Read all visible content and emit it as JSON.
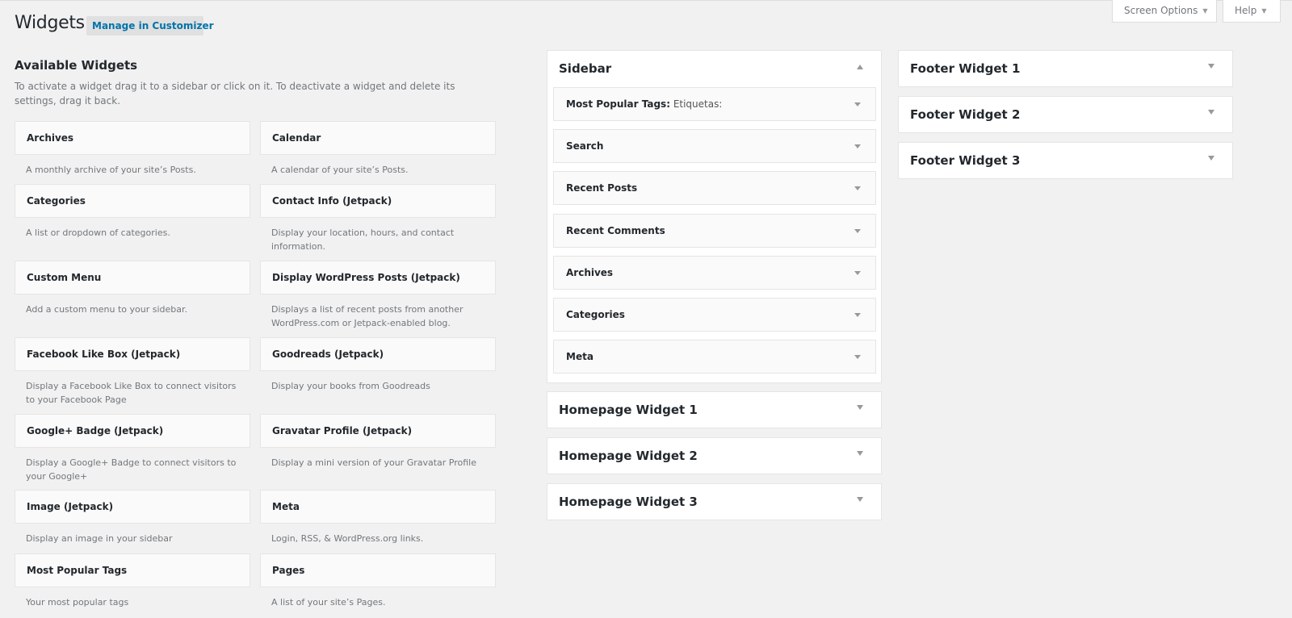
{
  "header": {
    "title": "Widgets",
    "customizer_button": "Manage in Customizer",
    "screen_options": "Screen Options",
    "help": "Help"
  },
  "available": {
    "title": "Available Widgets",
    "description": "To activate a widget drag it to a sidebar or click on it. To deactivate a widget and delete its settings, drag it back.",
    "widgets": [
      {
        "name": "Archives",
        "desc": "A monthly archive of your site’s Posts."
      },
      {
        "name": "Calendar",
        "desc": "A calendar of your site’s Posts."
      },
      {
        "name": "Categories",
        "desc": "A list or dropdown of categories."
      },
      {
        "name": "Contact Info (Jetpack)",
        "desc": "Display your location, hours, and contact information."
      },
      {
        "name": "Custom Menu",
        "desc": "Add a custom menu to your sidebar."
      },
      {
        "name": "Display WordPress Posts (Jetpack)",
        "desc": "Displays a list of recent posts from another WordPress.com or Jetpack-enabled blog."
      },
      {
        "name": "Facebook Like Box (Jetpack)",
        "desc": "Display a Facebook Like Box to connect visitors to your Facebook Page"
      },
      {
        "name": "Goodreads (Jetpack)",
        "desc": "Display your books from Goodreads"
      },
      {
        "name": "Google+ Badge (Jetpack)",
        "desc": "Display a Google+ Badge to connect visitors to your Google+"
      },
      {
        "name": "Gravatar Profile (Jetpack)",
        "desc": "Display a mini version of your Gravatar Profile"
      },
      {
        "name": "Image (Jetpack)",
        "desc": "Display an image in your sidebar"
      },
      {
        "name": "Meta",
        "desc": "Login, RSS, & WordPress.org links."
      },
      {
        "name": "Most Popular Tags",
        "desc": "Your most popular tags"
      },
      {
        "name": "Pages",
        "desc": "A list of your site’s Pages."
      }
    ]
  },
  "sidebar": {
    "title": "Sidebar",
    "widgets": [
      {
        "name": "Most Popular Tags:",
        "sub": " Etiquetas:"
      },
      {
        "name": "Search",
        "sub": ""
      },
      {
        "name": "Recent Posts",
        "sub": ""
      },
      {
        "name": "Recent Comments",
        "sub": ""
      },
      {
        "name": "Archives",
        "sub": ""
      },
      {
        "name": "Categories",
        "sub": ""
      },
      {
        "name": "Meta",
        "sub": ""
      }
    ]
  },
  "homepage_areas": [
    "Homepage Widget 1",
    "Homepage Widget 2",
    "Homepage Widget 3"
  ],
  "footer_areas": [
    "Footer Widget 1",
    "Footer Widget 2",
    "Footer Widget 3"
  ]
}
